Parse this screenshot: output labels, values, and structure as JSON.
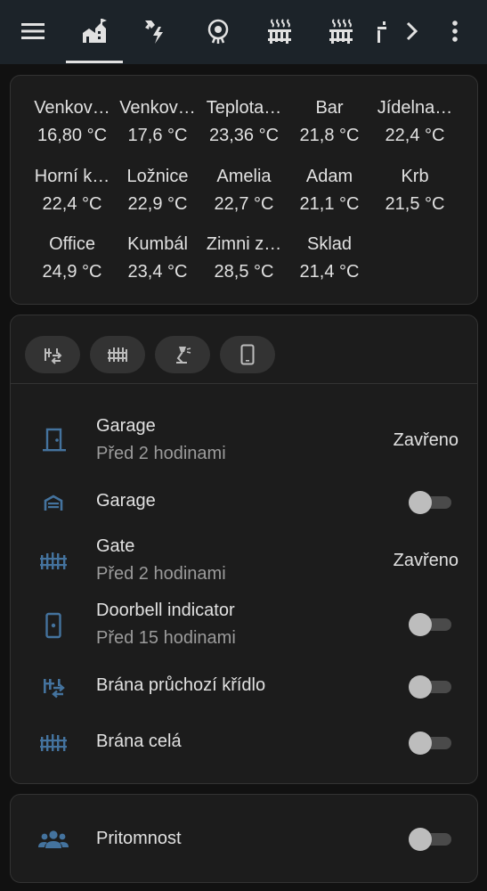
{
  "colors": {
    "background": "#111111",
    "topbar": "#1c2329",
    "card": "#1c1c1c",
    "icon_accent": "#44739e",
    "text_primary": "#e1e1e1",
    "text_secondary": "#9b9b9b"
  },
  "topbar": {
    "menu_icon": "hamburger-menu-icon",
    "tabs": [
      {
        "icon": "home-garden-icon",
        "active": true
      },
      {
        "icon": "lightning-bolt-icon",
        "active": false
      },
      {
        "icon": "ceiling-light-icon",
        "active": false
      },
      {
        "icon": "radiator-icon",
        "active": false
      },
      {
        "icon": "radiator-icon",
        "active": false
      },
      {
        "icon": "partial-icon",
        "active": false
      }
    ],
    "scroll_right_icon": "chevron-right-icon",
    "more_icon": "dots-vertical-icon"
  },
  "sensors": [
    {
      "name": "Venkov…",
      "value": "16,80 °C"
    },
    {
      "name": "Venkov…",
      "value": "17,6 °C"
    },
    {
      "name": "Teplota…",
      "value": "23,36 °C"
    },
    {
      "name": "Bar",
      "value": "21,8 °C"
    },
    {
      "name": "Jídelna…",
      "value": "22,4 °C"
    },
    {
      "name": "Horní k…",
      "value": "22,4 °C"
    },
    {
      "name": "Ložnice",
      "value": "22,9 °C"
    },
    {
      "name": "Amelia",
      "value": "22,7 °C"
    },
    {
      "name": "Adam",
      "value": "21,1 °C"
    },
    {
      "name": "Krb",
      "value": "21,5 °C"
    },
    {
      "name": "Office",
      "value": "24,9 °C"
    },
    {
      "name": "Kumbál",
      "value": "23,4 °C"
    },
    {
      "name": "Zimni z…",
      "value": "28,5 °C"
    },
    {
      "name": "Sklad",
      "value": "21,4 °C"
    }
  ],
  "chips": [
    {
      "icon": "gate-arrow-icon"
    },
    {
      "icon": "gate-icon"
    },
    {
      "icon": "desk-lamp-icon"
    },
    {
      "icon": "cellphone-icon"
    }
  ],
  "entities": [
    {
      "name": "Garage",
      "secondary": "Před 2 hodinami",
      "state": "Zavřeno",
      "icon": "door-icon"
    },
    {
      "name": "Garage",
      "toggle": false,
      "icon": "garage-icon"
    },
    {
      "name": "Gate",
      "secondary": "Před 2 hodinami",
      "state": "Zavřeno",
      "icon": "gate-icon"
    },
    {
      "name": "Doorbell indicator",
      "secondary": "Před 15 hodinami",
      "toggle": false,
      "icon": "doorbell-icon"
    },
    {
      "name": "Brána průchozí křídlo",
      "toggle": false,
      "icon": "gate-arrow-icon"
    },
    {
      "name": "Brána celá",
      "toggle": false,
      "icon": "gate-icon"
    }
  ],
  "presence": {
    "name": "Pritomnost",
    "toggle": false,
    "icon": "account-group-icon"
  }
}
